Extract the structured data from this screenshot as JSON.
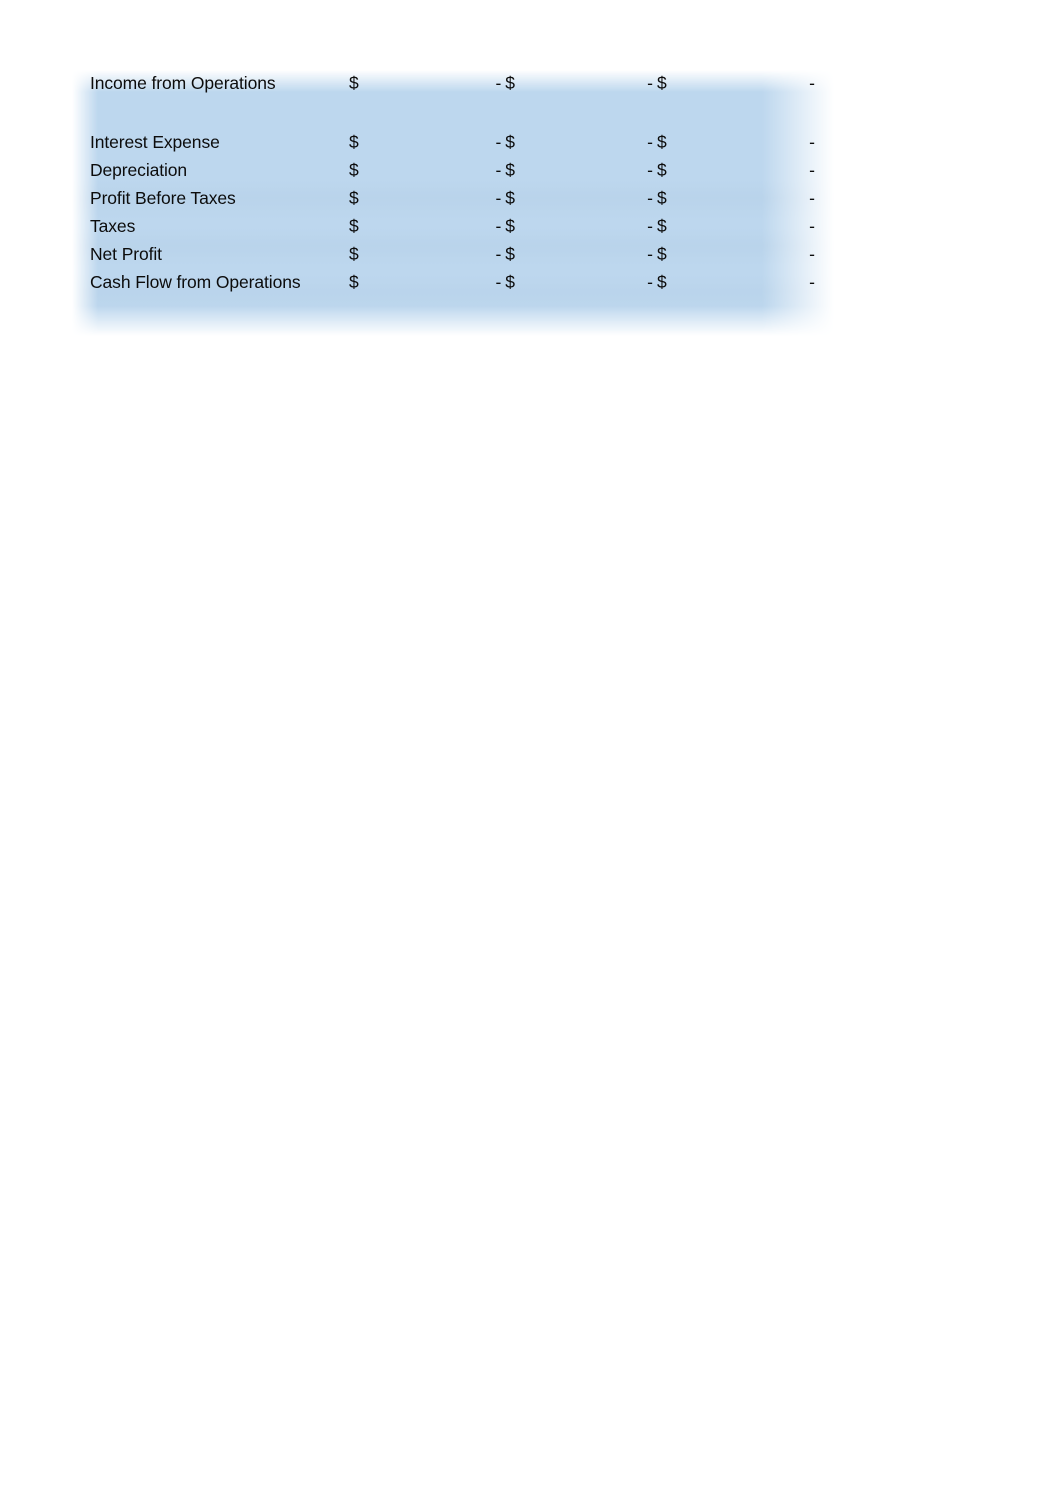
{
  "document": {
    "type": "spreadsheet-fragment",
    "background_color": "#ffffff",
    "cell_fill_color": "#bdd7ee",
    "text_color": "#0c0c0c",
    "currency_symbol": "$",
    "zero_value_display": "-"
  },
  "table": {
    "columns": [
      {
        "key": "label",
        "header": ""
      },
      {
        "key": "year1",
        "header": ""
      },
      {
        "key": "year2",
        "header": ""
      },
      {
        "key": "year3",
        "header": ""
      }
    ],
    "rows": [
      {
        "label": "Income from Operations",
        "currency": [
          "$",
          "$",
          "$"
        ],
        "values": [
          "-",
          "-",
          "-"
        ]
      },
      {
        "label": "",
        "currency": [
          "",
          "",
          ""
        ],
        "values": [
          "",
          "",
          ""
        ]
      },
      {
        "label": "Interest Expense",
        "currency": [
          "$",
          "$",
          "$"
        ],
        "values": [
          "-",
          "-",
          "-"
        ]
      },
      {
        "label": "Depreciation",
        "currency": [
          "$",
          "$",
          "$"
        ],
        "values": [
          "-",
          "-",
          "-"
        ]
      },
      {
        "label": "Profit Before Taxes",
        "currency": [
          "$",
          "$",
          "$"
        ],
        "values": [
          "-",
          "-",
          "-"
        ]
      },
      {
        "label": "Taxes",
        "currency": [
          "$",
          "$",
          "$"
        ],
        "values": [
          "-",
          "-",
          "-"
        ]
      },
      {
        "label": "Net Profit",
        "currency": [
          "$",
          "$",
          "$"
        ],
        "values": [
          "-",
          "-",
          "-"
        ]
      },
      {
        "label": "Cash Flow from Operations",
        "currency": [
          "$",
          "$",
          "$"
        ],
        "values": [
          "-",
          "-",
          "-"
        ]
      }
    ]
  }
}
